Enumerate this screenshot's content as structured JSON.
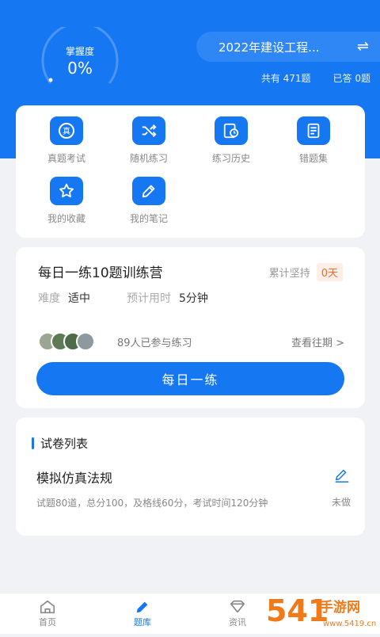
{
  "header": {
    "mastery_label": "掌握度",
    "mastery_value": "0%",
    "mastery_progress": 0,
    "subject": "2022年建设工程...",
    "swap_icon": "swap-icon",
    "total_questions": "共有 471题",
    "answered": "已答 0题"
  },
  "tools": [
    {
      "label": "真题考试",
      "icon": "exam-icon"
    },
    {
      "label": "随机练习",
      "icon": "shuffle-icon"
    },
    {
      "label": "练习历史",
      "icon": "history-icon"
    },
    {
      "label": "错题集",
      "icon": "notebook-icon"
    },
    {
      "label": "我的收藏",
      "icon": "star-icon"
    },
    {
      "label": "我的笔记",
      "icon": "pencil-icon"
    }
  ],
  "daily": {
    "title": "每日一练10题训练营",
    "streak_label": "累计坚持",
    "streak_value": "0天",
    "difficulty_label": "难度",
    "difficulty_value": "适中",
    "time_label": "预计用时",
    "time_value": "5分钟",
    "participants": "89人已参与练习",
    "history_link": "查看往期 >",
    "button": "每日一练"
  },
  "papers": {
    "section_title": "试卷列表",
    "items": [
      {
        "name": "模拟仿真法规",
        "desc": "试题80道，总分100，及格线60分，考试时间120分钟",
        "status": "未做"
      }
    ]
  },
  "tabbar": [
    {
      "label": "首页",
      "icon": "home-icon",
      "active": false
    },
    {
      "label": "题库",
      "icon": "pencil-icon",
      "active": true
    },
    {
      "label": "资讯",
      "icon": "diamond-icon",
      "active": false
    }
  ],
  "watermark": {
    "text": "5419手游网",
    "url_text": "www.5419.cn"
  },
  "colors": {
    "primary": "#1677f2",
    "streak": "#f06a2d"
  }
}
